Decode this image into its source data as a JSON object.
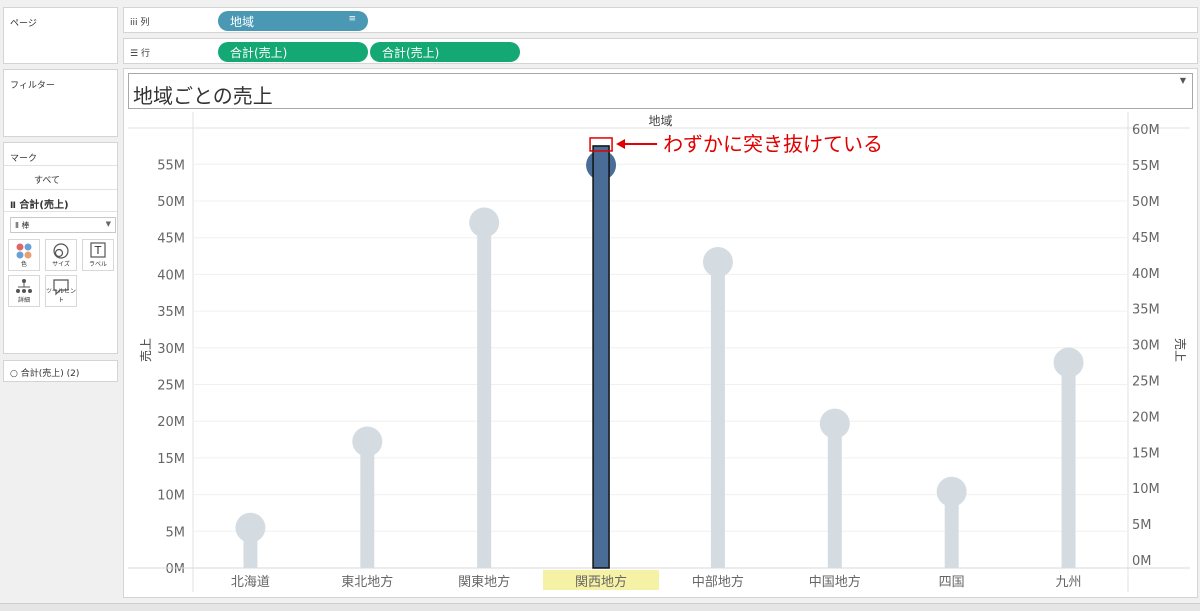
{
  "left_panels": {
    "pages_title": "ページ",
    "filters_title": "フィルター",
    "marks_title": "マーク",
    "marks_all": "すべて",
    "marks_measure": "合計(売上)",
    "mark_type": "棒",
    "mark_buttons": [
      {
        "label": "色",
        "icon": "color-dots-icon"
      },
      {
        "label": "サイズ",
        "icon": "size-circles-icon"
      },
      {
        "label": "ラベル",
        "icon": "text-label-icon"
      },
      {
        "label": "詳細",
        "icon": "detail-tree-icon"
      },
      {
        "label": "ツールヒント",
        "icon": "tooltip-bubble-icon"
      }
    ],
    "marks2_measure": "合計(売上) (2)"
  },
  "shelves": {
    "columns_label": "列",
    "rows_label": "行",
    "columns_pill": "地域",
    "rows_pills": [
      "合計(売上)",
      "合計(売上)"
    ]
  },
  "view": {
    "title": "地域ごとの売上"
  },
  "annotation": {
    "text": "わずかに突き抜けている",
    "color": "#e00000"
  },
  "colors": {
    "lollipop": "#d4dce2",
    "highlight_bar": "#4a6d97",
    "highlight_circle": "#4a6d97",
    "highlight_label_bg": "#f6f2a5",
    "column_pill": "#4a98b3",
    "row_pill": "#13a874"
  },
  "chart_data": {
    "type": "bar",
    "title": "地域ごとの売上",
    "column_header": "地域",
    "categories": [
      "北海道",
      "東北地方",
      "関東地方",
      "関西地方",
      "中部地方",
      "中国地方",
      "四国",
      "九州"
    ],
    "series": [
      {
        "name": "合計(売上)",
        "mark": "bar",
        "values": [
          4.5,
          16.5,
          47,
          55,
          41.5,
          19,
          9.5,
          27.5
        ]
      },
      {
        "name": "合計(売上) (2)",
        "mark": "circle",
        "values": [
          4.5,
          16.5,
          47,
          55,
          41.5,
          19,
          9.5,
          27.5
        ]
      }
    ],
    "highlighted_category": "関西地方",
    "highlighted_bar_value": 57.5,
    "left_axis": {
      "label": "売上",
      "ticks": [
        "0M",
        "5M",
        "10M",
        "15M",
        "20M",
        "25M",
        "30M",
        "35M",
        "40M",
        "45M",
        "50M",
        "55M"
      ],
      "range": [
        0,
        58
      ]
    },
    "right_axis": {
      "label": "売上",
      "ticks": [
        "0M",
        "5M",
        "10M",
        "15M",
        "20M",
        "25M",
        "30M",
        "35M",
        "40M",
        "45M",
        "50M",
        "55M",
        "60M"
      ],
      "range": [
        0,
        60
      ]
    },
    "grid": true,
    "unit": "M"
  }
}
